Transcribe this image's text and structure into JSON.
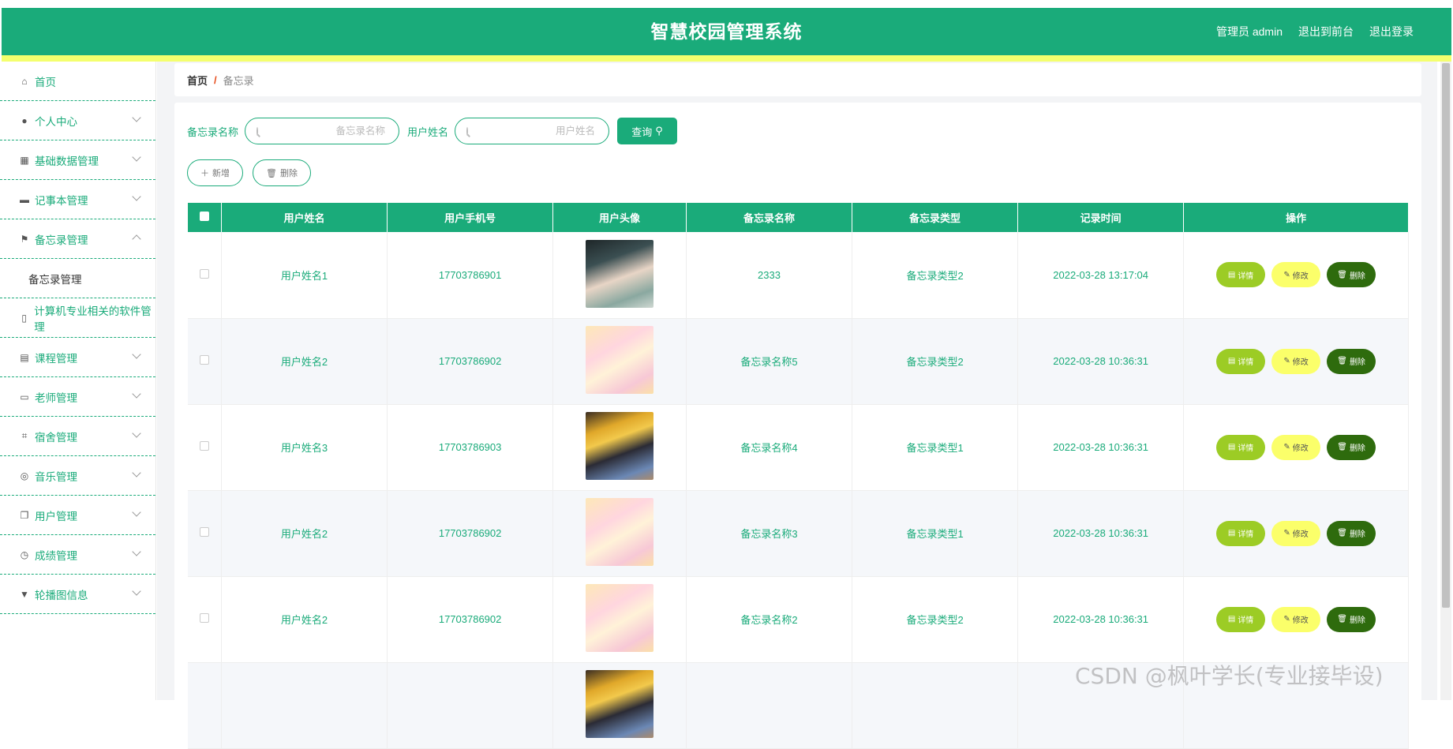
{
  "header": {
    "title": "智慧校园管理系统",
    "admin_label": "管理员 admin",
    "to_front": "退出到前台",
    "logout": "退出登录"
  },
  "sidebar": {
    "items": [
      {
        "label": "首页",
        "icon": "home-icon"
      },
      {
        "label": "个人中心",
        "icon": "user-icon"
      },
      {
        "label": "基础数据管理",
        "icon": "grid-icon"
      },
      {
        "label": "记事本管理",
        "icon": "briefcase-icon"
      },
      {
        "label": "备忘录管理",
        "icon": "flag-icon",
        "expanded": true,
        "sub": [
          "备忘录管理"
        ]
      },
      {
        "label": "计算机专业相关的软件管理",
        "icon": "mic-icon"
      },
      {
        "label": "课程管理",
        "icon": "clipboard-icon"
      },
      {
        "label": "老师管理",
        "icon": "id-card-icon"
      },
      {
        "label": "宿舍管理",
        "icon": "crop-icon"
      },
      {
        "label": "音乐管理",
        "icon": "target-icon"
      },
      {
        "label": "用户管理",
        "icon": "copy-icon"
      },
      {
        "label": "成绩管理",
        "icon": "clock-icon"
      },
      {
        "label": "轮播图信息",
        "icon": "hammer-icon"
      }
    ]
  },
  "breadcrumb": {
    "home": "首页",
    "sep": "/",
    "current": "备忘录"
  },
  "search": {
    "memo_label": "备忘录名称",
    "memo_placeholder": "备忘录名称",
    "user_label": "用户姓名",
    "user_placeholder": "用户姓名",
    "query_label": "查询"
  },
  "actions": {
    "add": "新增",
    "delete": "删除"
  },
  "table": {
    "columns": [
      "用户姓名",
      "用户手机号",
      "用户头像",
      "备忘录名称",
      "备忘录类型",
      "记录时间",
      "操作"
    ],
    "rows": [
      {
        "name": "用户姓名1",
        "phone": "17703786901",
        "avatar": "a",
        "memo": "2333",
        "type": "备忘录类型2",
        "time": "2022-03-28 13:17:04"
      },
      {
        "name": "用户姓名2",
        "phone": "17703786902",
        "avatar": "b",
        "memo": "备忘录名称5",
        "type": "备忘录类型2",
        "time": "2022-03-28 10:36:31"
      },
      {
        "name": "用户姓名3",
        "phone": "17703786903",
        "avatar": "c",
        "memo": "备忘录名称4",
        "type": "备忘录类型1",
        "time": "2022-03-28 10:36:31"
      },
      {
        "name": "用户姓名2",
        "phone": "17703786902",
        "avatar": "b",
        "memo": "备忘录名称3",
        "type": "备忘录类型1",
        "time": "2022-03-28 10:36:31"
      },
      {
        "name": "用户姓名2",
        "phone": "17703786902",
        "avatar": "b",
        "memo": "备忘录名称2",
        "type": "备忘录类型2",
        "time": "2022-03-28 10:36:31"
      }
    ],
    "op_detail": "详情",
    "op_edit": "修改",
    "op_delete": "删除"
  },
  "watermark": "CSDN @枫叶学长(专业接毕设)"
}
